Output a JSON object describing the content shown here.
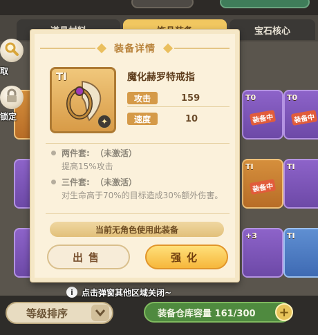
{
  "background": {
    "tabs": [
      {
        "label": "道具材料",
        "active": false
      },
      {
        "label": "饰品装备",
        "active": true
      },
      {
        "label": "宝石核心",
        "active": false
      }
    ],
    "left_buttons": [
      {
        "label": "取",
        "icon": "magnifier-icon"
      },
      {
        "label": "锁定",
        "icon": "lock-icon"
      }
    ],
    "cards": [
      {
        "tier": "T0",
        "equipped_label": "装备中",
        "color": "gold"
      },
      {
        "tier": "T0",
        "equipped_label": "装备中",
        "color": "purple"
      },
      {
        "tier": "TI",
        "equipped_label": "装备中",
        "color": "purple"
      },
      {
        "tier": "TI",
        "equipped_label": "",
        "color": "gold"
      },
      {
        "tier": "+3",
        "equipped_label": "",
        "color": "purple"
      },
      {
        "tier": "TI",
        "equipped_label": "",
        "color": "blue"
      }
    ]
  },
  "popup": {
    "title": "装备详情",
    "item": {
      "tier": "TI",
      "name": "魔化赫罗特戒指",
      "stats": [
        {
          "label": "攻击",
          "value": "159"
        },
        {
          "label": "速度",
          "value": "10"
        }
      ]
    },
    "sets": [
      {
        "name": "两件套:",
        "status": "（未激活）",
        "desc": "提高15%攻击"
      },
      {
        "name": "三件套:",
        "status": "（未激活）",
        "desc": "对生命高于70%的目标造成30%额外伤害。"
      }
    ],
    "usage_status": "当前无角色使用此装备",
    "buttons": {
      "sell": "出售",
      "enhance": "强化"
    }
  },
  "dismiss_hint": "点击弹窗其他区域关闭~",
  "bottom": {
    "sort_label": "等级排序",
    "capacity_label": "装备仓库容量 161/300"
  },
  "colors": {
    "accent_gold": "#f6b73c",
    "title_brown": "#b9833b",
    "stat_label_bg": "#d59a48",
    "capacity_green": "#4f8a3f"
  }
}
